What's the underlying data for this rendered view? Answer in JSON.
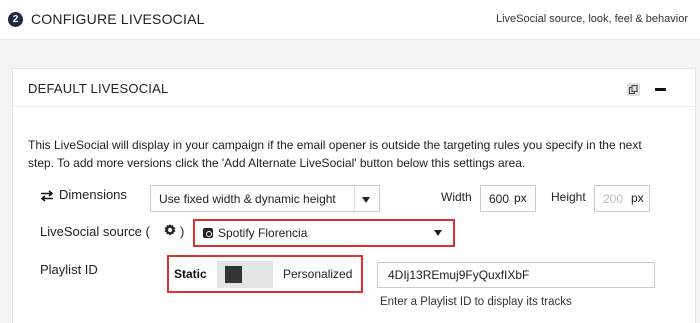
{
  "header": {
    "step_number": "2",
    "title": "CONFIGURE LIVESOCIAL",
    "subtitle": "LiveSocial source, look, feel & behavior"
  },
  "panel": {
    "title": "DEFAULT LIVESOCIAL",
    "intro_text": "This LiveSocial will display in your campaign if the email opener is outside the targeting rules you specify in the next step. To add more versions click the 'Add Alternate LiveSocial' button below this settings area."
  },
  "dimensions": {
    "label": "Dimensions",
    "mode_value": "Use fixed width & dynamic height",
    "width_label": "Width",
    "width_value": "600",
    "width_unit": "px",
    "height_label": "Height",
    "height_placeholder": "200",
    "height_unit": "px"
  },
  "source": {
    "label": "LiveSocial source (",
    "label_close": ")",
    "value": "Spotify Florencia"
  },
  "playlist": {
    "label": "Playlist ID",
    "toggle_static_label": "Static",
    "toggle_personalized_label": "Personalized",
    "value": "4DIj13REmuj9FyQuxfIXbF",
    "hint": "Enter a Playlist ID to display its tracks"
  },
  "icons": [
    "step-number-badge",
    "copy-icon",
    "collapse-minus-icon",
    "dimensions-arrows-icon",
    "gear-icon",
    "caret-down-icon",
    "rss-feed-icon"
  ],
  "colors": {
    "badge": "#1f2a44",
    "highlight": "#e03030",
    "toggle_knob": "#333333"
  }
}
